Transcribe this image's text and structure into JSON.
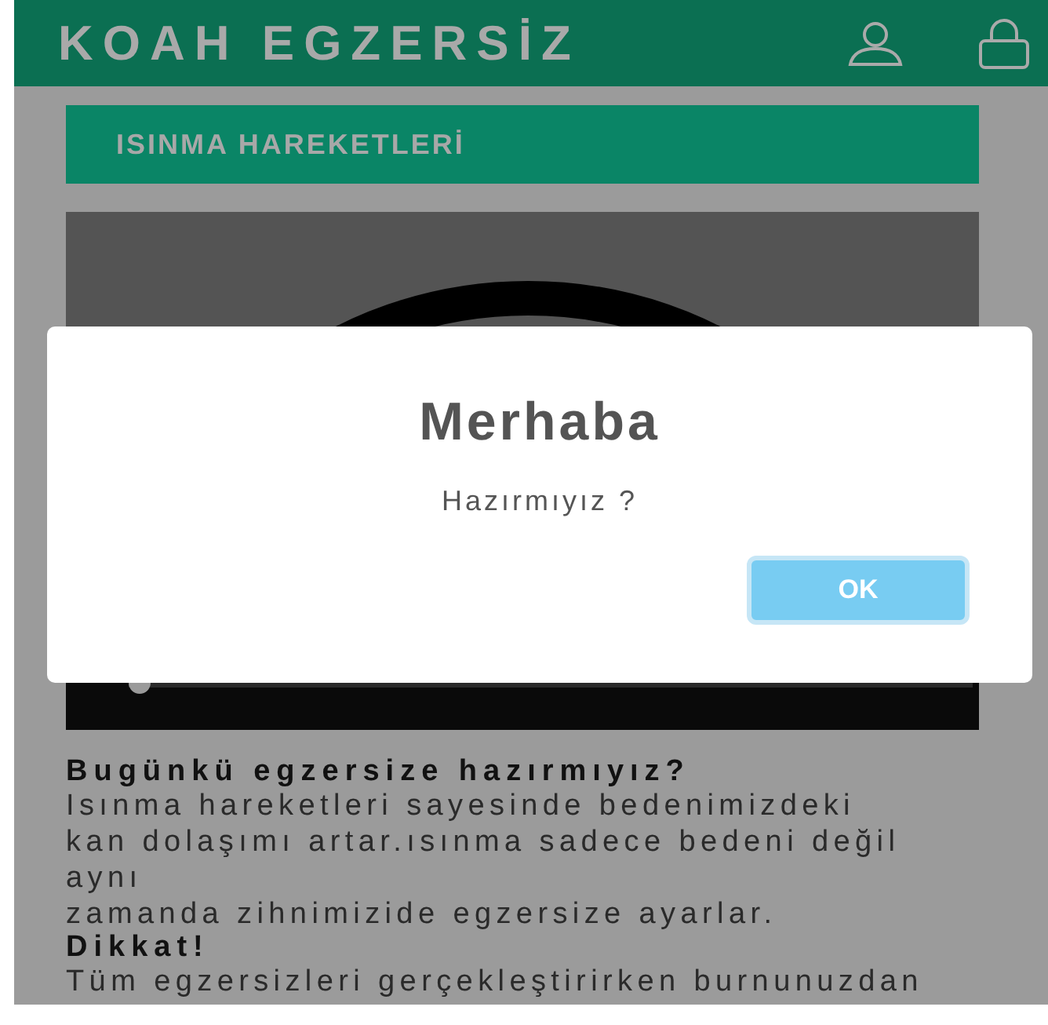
{
  "app_bar": {
    "title": "KOAH EGZERSİZ"
  },
  "section": {
    "title": "ISINMA HAREKETLERİ"
  },
  "video": {
    "level": 0
  },
  "content": [
    {
      "kind": "heading",
      "text": "Bugünkü egzersize hazırmıyız?"
    },
    {
      "kind": "paragraph",
      "text": "Isınma hareketleri sayesinde bedenimizdeki\nkan dolaşımı artar.ısınma sadece bedeni değil\naynı\nzamanda zihnimizide egzersize ayarlar."
    },
    {
      "kind": "heading",
      "text": "Dikkat!"
    },
    {
      "kind": "paragraph",
      "text": "Tüm egzersizleri gerçekleştirirken burnunuzdan"
    }
  ],
  "dialog": {
    "title": "Merhaba",
    "message": "Hazırmıyız ?",
    "button": "OK"
  }
}
